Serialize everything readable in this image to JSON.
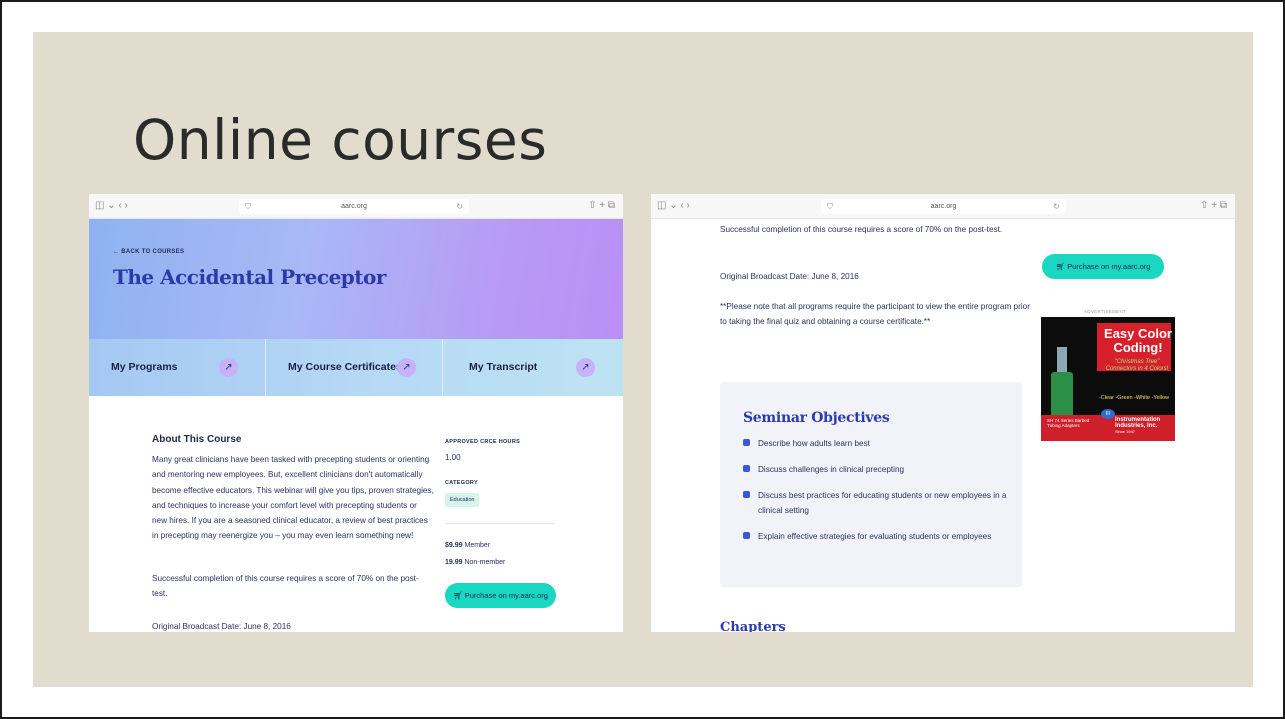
{
  "slide": {
    "title": "Online courses"
  },
  "browser_left": {
    "url": "aarc.org",
    "toolbar_left": "◫ ⌄  ‹  ›",
    "toolbar_right": "⇧  +  ⧉",
    "back_link": "← BACK TO COURSES",
    "course_title": "The Accidental Preceptor",
    "nav_cards": [
      {
        "label": "My Programs"
      },
      {
        "label": "My Course Certificates"
      },
      {
        "label": "My Transcript"
      }
    ],
    "about": {
      "heading": "About This Course",
      "text": "Many great clinicians have been tasked with precepting students or orienting and mentoring new employees. But, excellent clinicians don't automatically become effective educators. This webinar will give you tips, proven strategies, and techniques to increase your comfort level with precepting students or new hires. If you are a seasoned clinical educator, a review of best practices in precepting may reenergize you – you may even learn something new!",
      "completion": "Successful completion of this course requires a score of 70% on the post-test.",
      "broadcast": "Original Broadcast Date: June 8, 2016"
    },
    "sidebar": {
      "hours_label": "APPROVED CRCE HOURS",
      "hours_value": "1.00",
      "category_label": "CATEGORY",
      "category_value": "Education",
      "member_price": "$9.99",
      "member_label": "Member",
      "nonmember_price": "19.99",
      "nonmember_label": "Non-member",
      "purchase_label": "Purchase on my.aarc.org"
    }
  },
  "browser_right": {
    "url": "aarc.org",
    "toolbar_left": "◫ ⌄  ‹  ›",
    "toolbar_right": "⇧  +  ⧉",
    "completion": "Successful completion of this course requires a score of 70% on the post-test.",
    "broadcast": "Original Broadcast Date: June 8, 2016",
    "note": "**Please note that all programs require the participant to view the entire program prior to taking the final quiz and obtaining a course certificate.**",
    "purchase_label": "Purchase on my.aarc.org",
    "ad": {
      "label": "ADVERTISEMENT",
      "title": "Easy Color Coding!",
      "subtitle": "\"Christmas Tree\" Connectors in 4 Colors!",
      "colors": "-Clear -Green -White -Yellow",
      "series": "SH 74 Series Barbed Tubing Adapters",
      "company": "Instrumentation Industries, Inc.",
      "since": "Since 1947",
      "logo": "III"
    },
    "objectives": {
      "heading": "Seminar Objectives",
      "items": [
        "Describe how adults learn best",
        "Discuss challenges in clinical precepting",
        "Discuss best practices for educating students or new employees in a clinical setting",
        "Explain effective strategies for evaluating students or employees"
      ]
    },
    "chapters_heading": "Chapters"
  },
  "colors": {
    "slide_background": "#e2dccf",
    "accent_teal": "#19d7c0",
    "heading_blue": "#2b3ab0",
    "ad_red": "#d8202c"
  }
}
